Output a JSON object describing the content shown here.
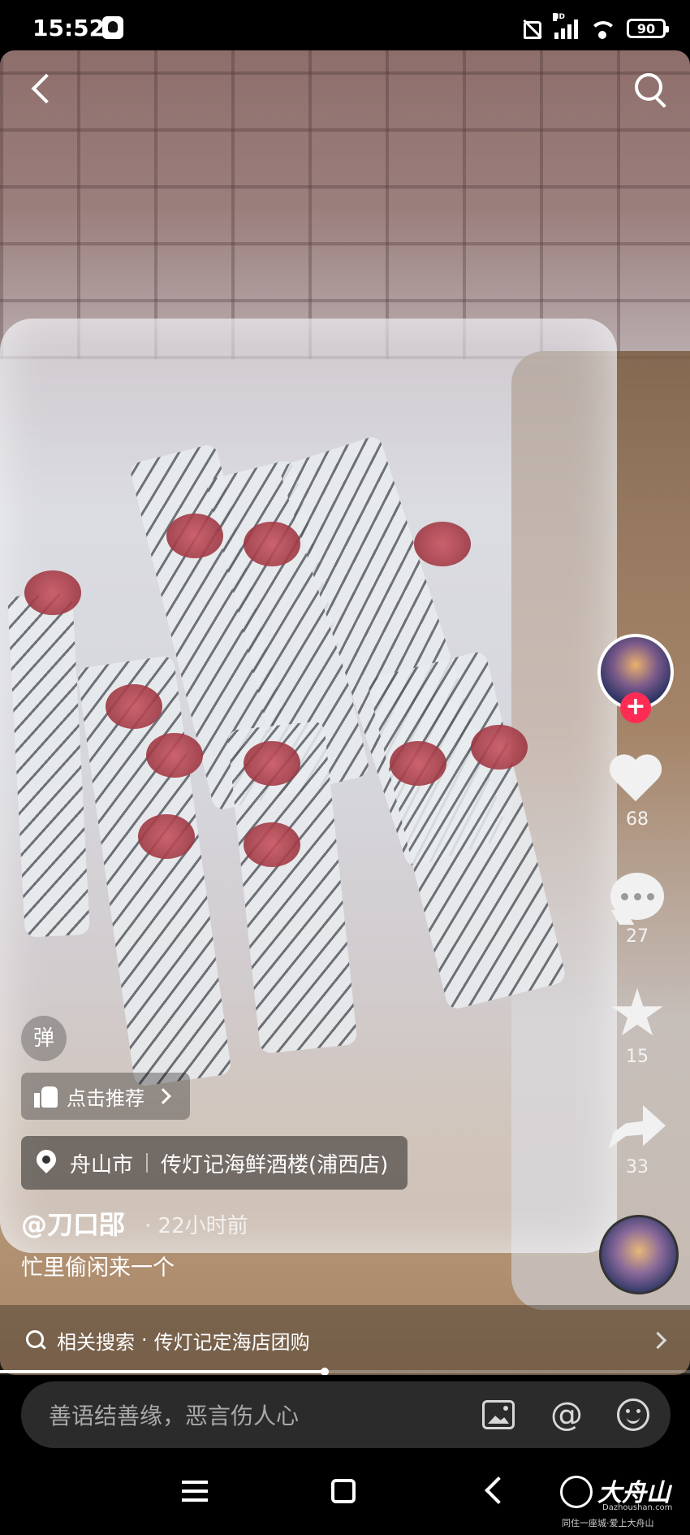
{
  "status_bar": {
    "time": "15:52",
    "network_badge": "HD",
    "battery": "90"
  },
  "video": {
    "author": "@刀口郘",
    "post_time": "· 22小时前",
    "caption": "忙里偷闲来一个",
    "progress": 0.47
  },
  "actions": {
    "like_count": "68",
    "comment_count": "27",
    "favorite_count": "15",
    "share_count": "33",
    "follow_symbol": "+"
  },
  "overlay": {
    "danmaku_label": "弹",
    "recommend_label": "点击推荐",
    "location_city": "舟山市",
    "location_place": "传灯记海鲜酒楼(浦西店)"
  },
  "related_search": {
    "prefix": "相关搜索",
    "separator": "·",
    "query": "传灯记定海店团购"
  },
  "comment_input": {
    "placeholder": "善语结善缘，恶言伤人心",
    "at_symbol": "@"
  },
  "watermark": {
    "name": "大舟山",
    "domain": "Dazhoushan.com",
    "slogan": "同住一座城·爱上大舟山"
  },
  "colors": {
    "accent": "#fe2c55",
    "background": "#000000",
    "input_bg": "#2b2b2b"
  },
  "icons": [
    "back-icon",
    "search-icon",
    "heart-icon",
    "comment-icon",
    "star-icon",
    "share-icon",
    "thumb-up-icon",
    "location-pin-icon",
    "image-icon",
    "at-icon",
    "emoji-icon",
    "menu-icon",
    "home-icon",
    "nav-back-icon"
  ]
}
